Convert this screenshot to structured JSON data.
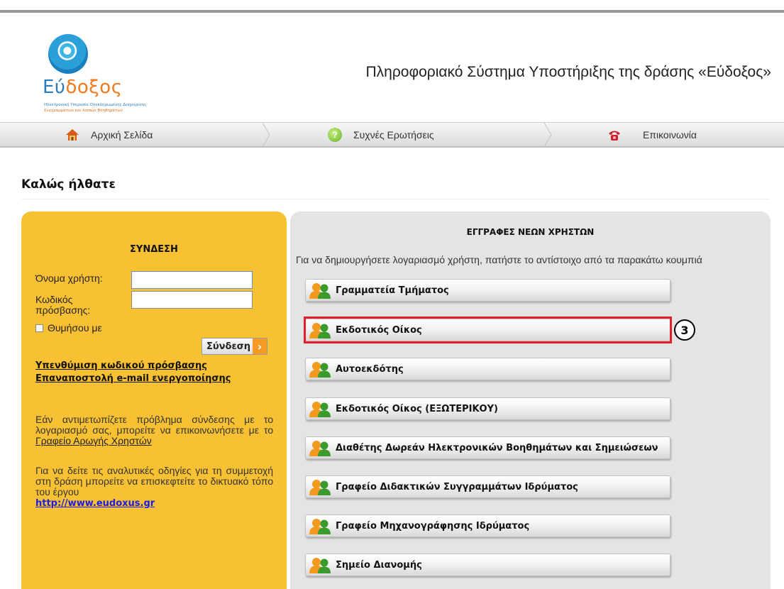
{
  "header": {
    "logo": {
      "word_prefix": "Εύ",
      "word_accent": "δοξος",
      "tagline_1": "Ηλεκτρονική Υπηρεσία Ολοκληρωμένης Διαχείρισης",
      "tagline_2": "Συγγραμμάτων και λοιπών Βοηθημάτων"
    },
    "site_title": "Πληροφοριακό Σύστημα Υποστήριξης της δράσης «Εύδοξος»"
  },
  "nav": {
    "items": [
      {
        "label": "Αρχική Σελίδα",
        "icon": "home-icon"
      },
      {
        "label": "Συχνές Ερωτήσεις",
        "icon": "help-icon"
      },
      {
        "label": "Επικοινωνία",
        "icon": "phone-icon"
      }
    ]
  },
  "welcome": {
    "title": "Καλώς ήλθατε"
  },
  "login": {
    "title": "ΣΥΝΔΕΣΗ",
    "username_label": "Όνομα χρήστη:",
    "password_label_1": "Κωδικός",
    "password_label_2": "πρόσβασης:",
    "username_value": "",
    "password_value": "",
    "remember_label": "Θυμήσου με",
    "submit_label": "Σύνδεση",
    "forgot_password_link": "Υπενθύμιση κωδικού πρόσβασης",
    "resend_email_link": "Επαναποστολή e-mail ενεργοποίησης",
    "help_text_1": "Εάν αντιμετωπίζετε πρόβλημα σύνδεσης με το λογαριασμό σας, μπορείτε να επικοινωνήσετε με το ",
    "help_link": "Γραφείο Αρωγής Χρηστών",
    "guide_text": "Για να δείτε τις αναλυτικές οδηγίες για τη συμμετοχή στη δράση μπορείτε να επισκεφτείτε το δικτυακό τόπο του έργου",
    "guide_url": "http://www.eudoxus.gr"
  },
  "registration": {
    "title": "ΕΓΓΡΑΦΕΣ ΝΕΩΝ ΧΡΗΣΤΩΝ",
    "subtitle": "Για να δημιουργήσετε λογαριασμό χρήστη, πατήστε το αντίστοιχο από τα παρακάτω κουμπιά",
    "buttons": [
      {
        "label": "Γραμματεία Τμήματος"
      },
      {
        "label": "Εκδοτικός Οίκος"
      },
      {
        "label": "Αυτοεκδότης"
      },
      {
        "label": "Εκδοτικός Οίκος (ΕΞΩΤΕΡΙΚΟΥ)"
      },
      {
        "label": "Διαθέτης Δωρεάν Ηλεκτρονικών Βοηθημάτων και Σημειώσεων"
      },
      {
        "label": "Γραφείο Διδακτικών Συγγραμμάτων Ιδρύματος"
      },
      {
        "label": "Γραφείο Μηχανογράφησης Ιδρύματος"
      },
      {
        "label": "Σημείο Διανομής"
      }
    ],
    "highlighted_index": 1,
    "annotation_badge": "3"
  },
  "colors": {
    "login_panel": "#f8c033",
    "registration_panel": "#e4e4e4",
    "highlight": "#e0202a",
    "link": "#1a1aee",
    "brand_blue": "#2a7bc0",
    "brand_orange": "#f07a1a"
  }
}
